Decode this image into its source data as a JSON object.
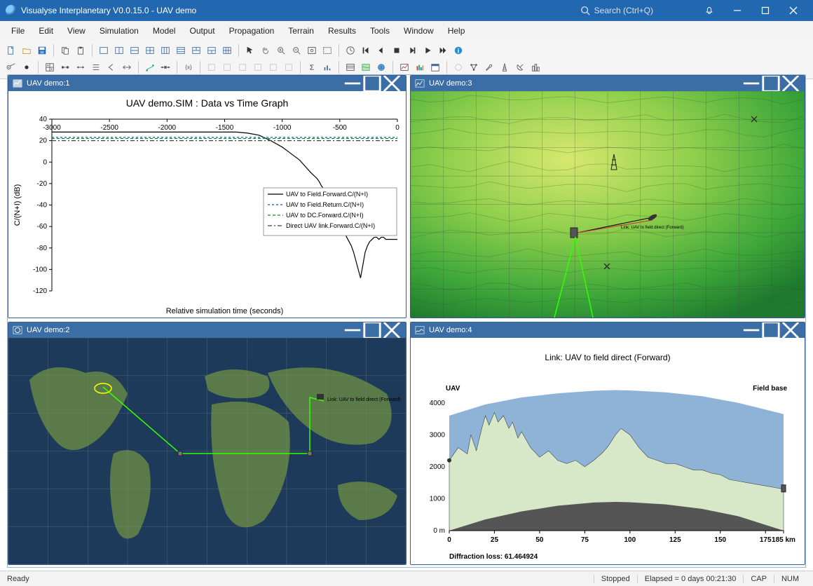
{
  "window": {
    "title": "Visualyse Interplanetary V0.0.15.0 - UAV demo",
    "search_placeholder": "Search (Ctrl+Q)"
  },
  "menu": [
    "File",
    "Edit",
    "View",
    "Simulation",
    "Model",
    "Output",
    "Propagation",
    "Terrain",
    "Results",
    "Tools",
    "Window",
    "Help"
  ],
  "panes": {
    "p1": {
      "title": "UAV demo:1"
    },
    "p2": {
      "title": "UAV demo:2"
    },
    "p3": {
      "title": "UAV demo:3"
    },
    "p4": {
      "title": "UAV demo:4"
    }
  },
  "status": {
    "left": "Ready",
    "state": "Stopped",
    "elapsed": "Elapsed = 0 days 00:21:30",
    "cap": "CAP",
    "num": "NUM"
  },
  "chart_data": [
    {
      "id": "p1",
      "type": "line",
      "title": "UAV demo.SIM : Data vs Time Graph",
      "xlabel": "Relative simulation time (seconds)",
      "ylabel": "C/(N+I) (dB)",
      "x_ticks": [
        -3000,
        -2500,
        -2000,
        -1500,
        -1000,
        -500,
        0
      ],
      "y_ticks": [
        -120,
        -100,
        -80,
        -60,
        -40,
        -20,
        0,
        20,
        40
      ],
      "xlim": [
        -3000,
        0
      ],
      "ylim": [
        -120,
        40
      ],
      "series": [
        {
          "name": "UAV to Field.Forward.C/(N+I)",
          "color": "#000000",
          "dash": "",
          "x": [
            -3000,
            -1400,
            -1300,
            -1200,
            -1100,
            -1000,
            -950,
            -900,
            -850,
            -800,
            -750,
            -700,
            -680,
            -660,
            -640,
            -620,
            -600,
            -580,
            -560,
            -540,
            -520,
            -500,
            -480,
            -460,
            -440,
            -420,
            -400,
            -380,
            -360,
            -340,
            -320,
            -300,
            -280,
            -260,
            -240,
            -220,
            -200,
            -180,
            -160,
            -140,
            -120,
            -100,
            -80,
            -60,
            -40,
            -20,
            0
          ],
          "y": [
            28,
            28,
            27,
            25,
            20,
            14,
            10,
            6,
            2,
            -4,
            -10,
            -15,
            -18,
            -22,
            -25,
            -30,
            -34,
            -40,
            -46,
            -52,
            -58,
            -60,
            -62,
            -66,
            -70,
            -74,
            -78,
            -84,
            -92,
            -100,
            -108,
            -96,
            -84,
            -78,
            -74,
            -72,
            -70,
            -70,
            -72,
            -70,
            -70,
            -72,
            -72,
            -72,
            -72,
            -72,
            -72
          ]
        },
        {
          "name": "UAV to Field.Return.C/(N+I)",
          "color": "#1155cc",
          "dash": "3,3",
          "x": [
            -3000,
            0
          ],
          "y": [
            23,
            23
          ]
        },
        {
          "name": "UAV to DC.Forward.C/(N+I)",
          "color": "#009900",
          "dash": "4,3",
          "x": [
            -3000,
            0
          ],
          "y": [
            22,
            22
          ]
        },
        {
          "name": "Direct UAV link.Forward.C/(N+I)",
          "color": "#444444",
          "dash": "6,3,2,3",
          "x": [
            -3000,
            0
          ],
          "y": [
            20,
            20
          ]
        }
      ]
    },
    {
      "id": "p4",
      "type": "area",
      "title": "Link: UAV to field direct (Forward)",
      "left_label": "UAV",
      "right_label": "Field base",
      "xlabel": "",
      "ylabel": "",
      "x_ticks": [
        0,
        25,
        50,
        75,
        100,
        125,
        150,
        175,
        185
      ],
      "x_unit": "km",
      "y_ticks": [
        0,
        1000,
        2000,
        3000,
        4000
      ],
      "y_unit_zero": "0 m",
      "footer": "Diffraction loss: 61.464924",
      "xlim": [
        0,
        185
      ],
      "ylim": [
        0,
        4500
      ],
      "terrain": {
        "x": [
          0,
          5,
          10,
          12,
          15,
          18,
          20,
          22,
          25,
          27,
          30,
          33,
          35,
          38,
          40,
          45,
          50,
          55,
          60,
          65,
          70,
          75,
          80,
          85,
          88,
          92,
          95,
          100,
          105,
          110,
          115,
          120,
          125,
          130,
          135,
          140,
          145,
          150,
          155,
          160,
          165,
          170,
          175,
          180,
          185
        ],
        "y": [
          2200,
          2600,
          2400,
          3000,
          2500,
          3200,
          3600,
          3300,
          3700,
          3400,
          3600,
          3200,
          3400,
          2900,
          3100,
          2600,
          2300,
          2500,
          2200,
          2100,
          2200,
          2000,
          2200,
          2450,
          2650,
          3000,
          3200,
          3000,
          2600,
          2300,
          2200,
          2100,
          2100,
          2000,
          1900,
          1900,
          1800,
          1750,
          1600,
          1550,
          1500,
          1450,
          1400,
          1350,
          1300
        ]
      },
      "earth_bulge": {
        "x": [
          0,
          20,
          40,
          60,
          80,
          92,
          100,
          120,
          140,
          160,
          185
        ],
        "y": [
          0,
          350,
          600,
          780,
          880,
          900,
          890,
          820,
          680,
          450,
          0
        ]
      },
      "sky_top": {
        "x": [
          0,
          20,
          40,
          60,
          80,
          92,
          100,
          120,
          140,
          160,
          185
        ],
        "y": [
          3600,
          3950,
          4170,
          4300,
          4380,
          4400,
          4390,
          4330,
          4210,
          4000,
          3650
        ]
      }
    }
  ],
  "map_overlay": {
    "p3_link_label": "Link: UAV to field direct (Forward)"
  }
}
